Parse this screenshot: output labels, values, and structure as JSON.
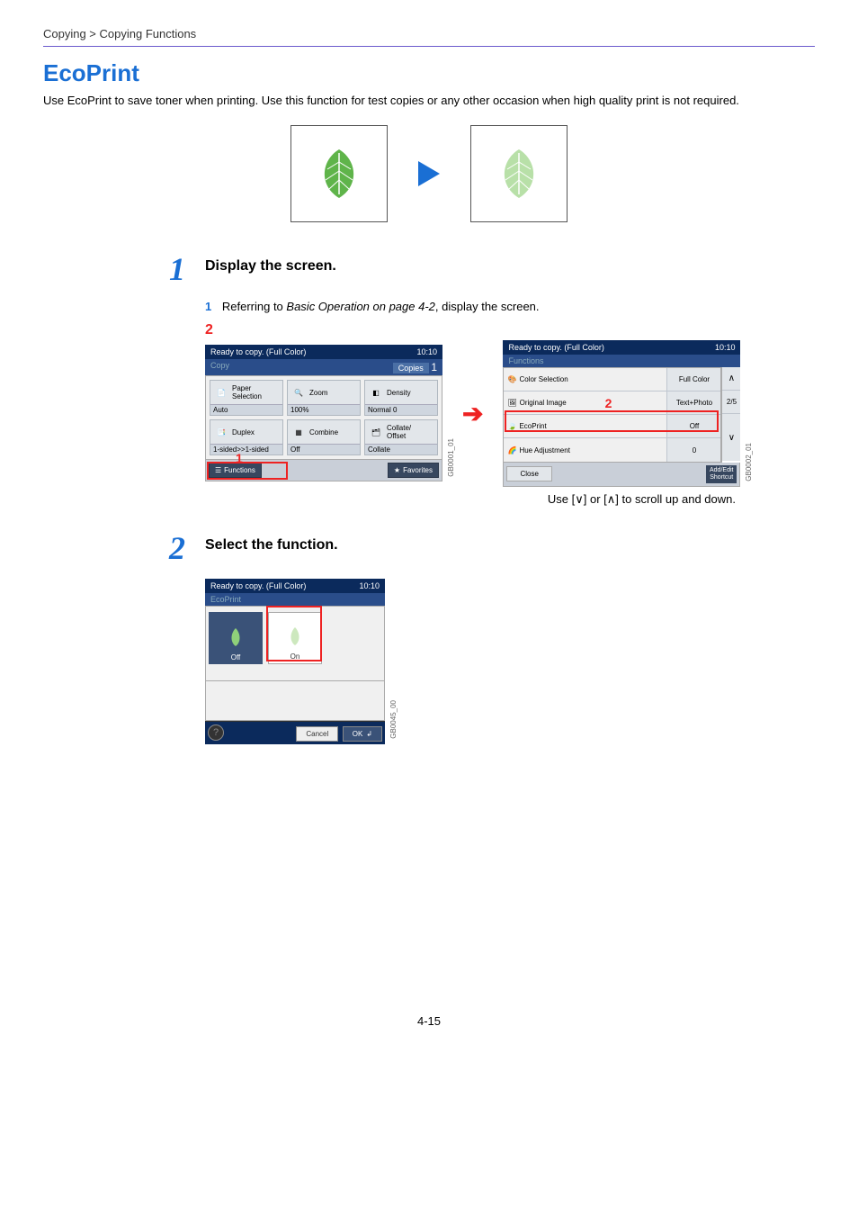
{
  "breadcrumb": "Copying > Copying Functions",
  "title": "EcoPrint",
  "intro": "Use EcoPrint to save toner when printing. Use this function for test copies or any other occasion when high quality print is not required.",
  "step1": {
    "num": "1",
    "heading": "Display the screen.",
    "sub_num": "1",
    "sub_text_prefix": "Referring to ",
    "sub_text_ital": "Basic Operation on page 4-2",
    "sub_text_suffix": ", display the screen.",
    "marker": "2"
  },
  "panel_a": {
    "status": "Ready to copy. (Full Color)",
    "time": "10:10",
    "tab": "Copy",
    "copies_label": "Copies",
    "copies_value": "1",
    "cells": [
      {
        "label": "Paper\nSelection",
        "status": "Auto"
      },
      {
        "label": "Zoom",
        "status": "100%"
      },
      {
        "label": "Density",
        "status": "Normal 0"
      },
      {
        "label": "Duplex",
        "status": "1-sided>>1-sided"
      },
      {
        "label": "Combine",
        "status": "Off"
      },
      {
        "label": "Collate/\nOffset",
        "status": "Collate"
      }
    ],
    "functions_btn": "Functions",
    "favorites_btn": "Favorites",
    "side_code": "GB0001_01",
    "overlay_1": "1"
  },
  "panel_b": {
    "status": "Ready to copy. (Full Color)",
    "time": "10:10",
    "tab": "Functions",
    "rows": [
      {
        "label": "Color Selection",
        "value": "Full Color"
      },
      {
        "label": "Original Image",
        "value": "Text+Photo"
      },
      {
        "label": "EcoPrint",
        "value": "Off"
      },
      {
        "label": "Hue Adjustment",
        "value": "0"
      }
    ],
    "page_ind": "2/5",
    "close": "Close",
    "add_edit": "Add/Edit\nShortcut",
    "side_code": "GB0002_01",
    "overlay_2": "2"
  },
  "scroll_note_pre": "Use [",
  "scroll_note_mid": "] or [",
  "scroll_note_post": "] to scroll up and down.",
  "step2": {
    "num": "2",
    "heading": "Select the function."
  },
  "panel_c": {
    "status": "Ready to copy. (Full Color)",
    "time": "10:10",
    "tab": "EcoPrint",
    "opt_off": "Off",
    "opt_on": "On",
    "cancel": "Cancel",
    "ok": "OK",
    "side_code": "GB0045_00"
  },
  "page_footer": "4-15"
}
